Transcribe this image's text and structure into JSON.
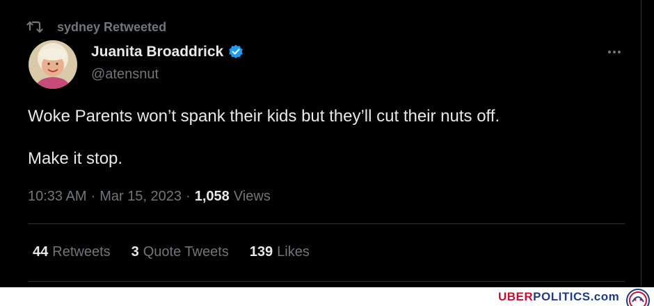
{
  "retweet": {
    "text": "sydney Retweeted",
    "icon": "retweet-icon"
  },
  "author": {
    "display_name": "Juanita Broaddrick",
    "handle": "@atensnut",
    "verified": true,
    "verified_color": "#1d9bf0"
  },
  "tweet": {
    "lines": [
      "Woke Parents won’t spank their kids but they’ll cut their nuts off.",
      "Make it stop."
    ]
  },
  "meta": {
    "time": "10:33 AM",
    "separator": "·",
    "date": "Mar 15, 2023",
    "views_count": "1,058",
    "views_label": "Views"
  },
  "stats": [
    {
      "count": "44",
      "label": "Retweets"
    },
    {
      "count": "3",
      "label": "Quote Tweets"
    },
    {
      "count": "139",
      "label": "Likes"
    }
  ],
  "watermark": {
    "part1": "UBER",
    "part2": "POLITICS.com",
    "color1": "#c8102e",
    "color2": "#1f3a8a"
  },
  "colors": {
    "background": "#000000",
    "text": "#e7e9ea",
    "muted": "#71767b",
    "divider": "#2f3336"
  }
}
